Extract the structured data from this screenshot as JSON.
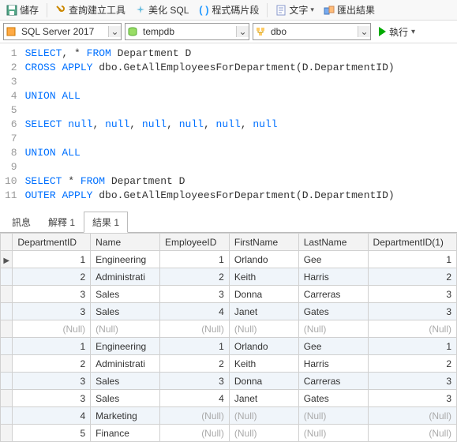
{
  "toolbar": {
    "save": "儲存",
    "query_builder": "查詢建立工具",
    "beautify": "美化 SQL",
    "snippets": "程式碼片段",
    "text": "文字",
    "export": "匯出結果"
  },
  "combos": {
    "server": "SQL Server 2017",
    "database": "tempdb",
    "schema": "dbo",
    "run": "執行"
  },
  "sql_lines": [
    {
      "n": 1,
      "t": [
        [
          "kw",
          "SELECT"
        ],
        [
          "",
          ", "
        ],
        [
          "",
          "* "
        ],
        [
          "kw",
          "FROM"
        ],
        [
          "",
          " Department D"
        ]
      ]
    },
    {
      "n": 2,
      "t": [
        [
          "kw",
          "CROSS"
        ],
        [
          "",
          " "
        ],
        [
          "kw",
          "APPLY"
        ],
        [
          "",
          " dbo.GetAllEmployeesForDepartment(D.DepartmentID)"
        ]
      ]
    },
    {
      "n": 3,
      "t": [
        [
          "",
          ""
        ]
      ]
    },
    {
      "n": 4,
      "t": [
        [
          "kw",
          "UNION ALL"
        ]
      ]
    },
    {
      "n": 5,
      "t": [
        [
          "",
          ""
        ]
      ]
    },
    {
      "n": 6,
      "t": [
        [
          "kw",
          "SELECT"
        ],
        [
          "",
          " "
        ],
        [
          "kw",
          "null"
        ],
        [
          "",
          ", "
        ],
        [
          "kw",
          "null"
        ],
        [
          "",
          ", "
        ],
        [
          "kw",
          "null"
        ],
        [
          "",
          ", "
        ],
        [
          "kw",
          "null"
        ],
        [
          "",
          ", "
        ],
        [
          "kw",
          "null"
        ],
        [
          "",
          ", "
        ],
        [
          "kw",
          "null"
        ]
      ]
    },
    {
      "n": 7,
      "t": [
        [
          "",
          ""
        ]
      ]
    },
    {
      "n": 8,
      "t": [
        [
          "kw",
          "UNION ALL"
        ]
      ]
    },
    {
      "n": 9,
      "t": [
        [
          "",
          ""
        ]
      ]
    },
    {
      "n": 10,
      "t": [
        [
          "kw",
          "SELECT"
        ],
        [
          "",
          " * "
        ],
        [
          "kw",
          "FROM"
        ],
        [
          "",
          " Department D"
        ]
      ]
    },
    {
      "n": 11,
      "t": [
        [
          "kw",
          "OUTER"
        ],
        [
          "",
          " "
        ],
        [
          "kw",
          "APPLY"
        ],
        [
          "",
          " dbo.GetAllEmployeesForDepartment(D.DepartmentID)"
        ]
      ]
    }
  ],
  "tabs": {
    "messages": "訊息",
    "explain": "解釋 1",
    "results": "結果 1"
  },
  "grid": {
    "headers": [
      "DepartmentID",
      "Name",
      "EmployeeID",
      "FirstName",
      "LastName",
      "DepartmentID(1)"
    ],
    "rows": [
      {
        "ptr": true,
        "d": [
          1,
          "Engineering",
          1,
          "Orlando",
          "Gee",
          1
        ]
      },
      {
        "d": [
          2,
          "Administrati",
          2,
          "Keith",
          "Harris",
          2
        ]
      },
      {
        "d": [
          3,
          "Sales",
          3,
          "Donna",
          "Carreras",
          3
        ]
      },
      {
        "d": [
          3,
          "Sales",
          4,
          "Janet",
          "Gates",
          3
        ]
      },
      {
        "d": [
          null,
          null,
          null,
          null,
          null,
          null
        ]
      },
      {
        "d": [
          1,
          "Engineering",
          1,
          "Orlando",
          "Gee",
          1
        ]
      },
      {
        "d": [
          2,
          "Administrati",
          2,
          "Keith",
          "Harris",
          2
        ]
      },
      {
        "d": [
          3,
          "Sales",
          3,
          "Donna",
          "Carreras",
          3
        ]
      },
      {
        "d": [
          3,
          "Sales",
          4,
          "Janet",
          "Gates",
          3
        ]
      },
      {
        "d": [
          4,
          "Marketing",
          null,
          null,
          null,
          null
        ]
      },
      {
        "d": [
          5,
          "Finance",
          null,
          null,
          null,
          null
        ]
      }
    ],
    "null_label": "(Null)"
  }
}
